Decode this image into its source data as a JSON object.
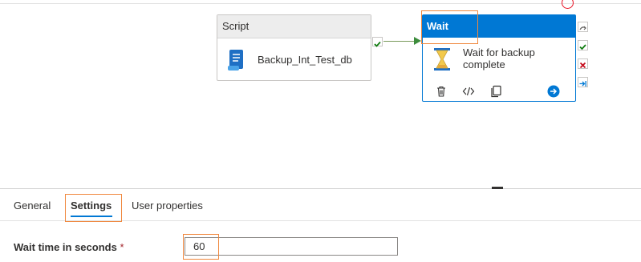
{
  "canvas": {
    "script_activity": {
      "header": "Script",
      "name": "Backup_Int_Test_db"
    },
    "wait_activity": {
      "header": "Wait",
      "description_line1": "Wait for backup",
      "description_line2": "complete",
      "actions": [
        "delete-icon",
        "code-icon",
        "copy-icon",
        "go-arrow-icon"
      ]
    },
    "side_buttons": [
      "skip-icon",
      "success-icon",
      "failure-icon",
      "completion-icon"
    ],
    "colors": {
      "accent": "#0078d4",
      "success": "#3c8c3c",
      "failure": "#c50f1f",
      "annotation": "#f0883e"
    }
  },
  "panel": {
    "tabs": [
      {
        "label": "General"
      },
      {
        "label": "Settings"
      },
      {
        "label": "User properties"
      }
    ],
    "active_tab": "Settings",
    "wait_time": {
      "label": "Wait time in seconds",
      "required_marker": "*",
      "value": "60"
    }
  }
}
